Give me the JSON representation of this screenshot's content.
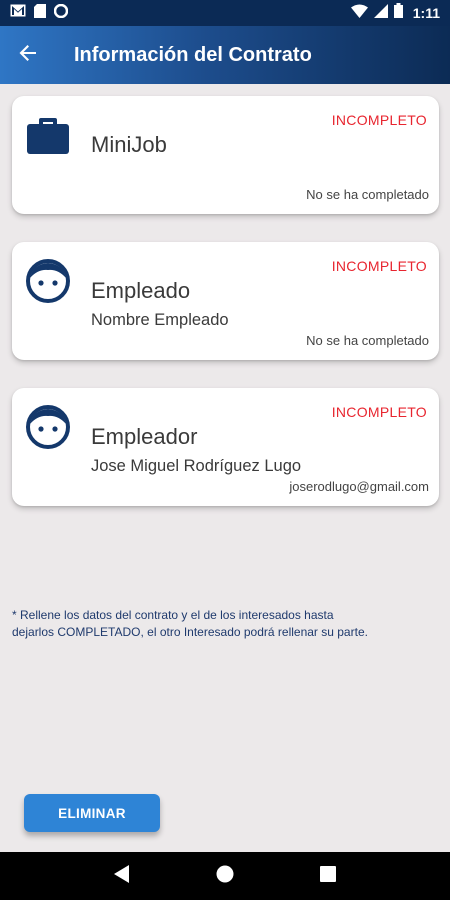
{
  "status_bar": {
    "time": "1:11",
    "icons": [
      "gmail-icon",
      "sd-card-icon",
      "circle-app-icon",
      "wifi-icon",
      "signal-icon",
      "battery-icon"
    ]
  },
  "app_bar": {
    "title": "Información del Contrato",
    "back_icon": "arrow-back-icon"
  },
  "cards": [
    {
      "icon": "briefcase-icon",
      "status": "INCOMPLETO",
      "title": "MiniJob",
      "subtitle": "",
      "note": "No se ha completado"
    },
    {
      "icon": "person-face-icon",
      "status": "INCOMPLETO",
      "title": "Empleado",
      "subtitle": "Nombre Empleado",
      "note": "No se ha completado"
    },
    {
      "icon": "person-face-icon",
      "status": "INCOMPLETO",
      "title": "Empleador",
      "subtitle": "Jose Miguel Rodríguez Lugo",
      "note": "joserodlugo@gmail.com"
    }
  ],
  "info_note": "* Rellene los datos del contrato y el de los interesados hasta dejarlos COMPLETADO, el otro Interesado podrá rellenar su parte.",
  "delete_button_label": "ELIMINAR",
  "colors": {
    "accent_blue": "#2e84d6",
    "dark_navy": "#0b2a55",
    "status_red": "#e8252f",
    "icon_navy": "#14386b",
    "background": "#ece9ea"
  },
  "nav_bar": {
    "buttons": [
      "back-triangle-icon",
      "home-circle-icon",
      "recents-square-icon"
    ]
  }
}
